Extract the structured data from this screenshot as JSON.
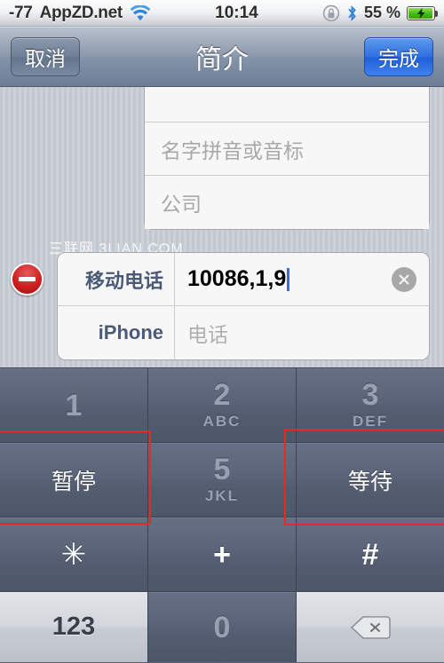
{
  "status_bar": {
    "signal_text": "-77",
    "carrier": "AppZD.net",
    "wifi_icon": "wifi-icon",
    "time": "10:14",
    "rotation_lock_icon": "rotation-lock-icon",
    "bluetooth_icon": "bluetooth-icon",
    "battery_percent": "55 %",
    "battery_icon": "battery-charging-icon"
  },
  "nav_bar": {
    "cancel_label": "取消",
    "title": "简介",
    "done_label": "完成"
  },
  "watermark": "三联网 3LIAN.COM",
  "form": {
    "name_group": {
      "rows": [
        {
          "placeholder": "名字拼音或音标"
        },
        {
          "placeholder": "公司"
        }
      ]
    },
    "phone_group": {
      "delete_icon": "delete-minus-icon",
      "rows": [
        {
          "label": "移动电话",
          "value": "10086,1,9",
          "has_caret": true,
          "clear_icon": "clear-x-icon"
        },
        {
          "label": "iPhone",
          "placeholder": "电话",
          "has_caret": false
        }
      ]
    }
  },
  "keyboard": {
    "rows": [
      [
        {
          "digit": "1",
          "sub": ""
        },
        {
          "digit": "2",
          "sub": "ABC"
        },
        {
          "digit": "3",
          "sub": "DEF"
        }
      ],
      [
        {
          "digit": "",
          "sub": "",
          "cn": "暂停"
        },
        {
          "digit": "5",
          "sub": "JKL"
        },
        {
          "digit": "",
          "sub": "",
          "cn": "等待"
        }
      ],
      [
        {
          "sym": "✳"
        },
        {
          "sym": "+"
        },
        {
          "sym": "#"
        }
      ],
      [
        {
          "num123": "123"
        },
        {
          "digit": "0",
          "sub": ""
        },
        {
          "icon": "backspace-icon"
        }
      ]
    ]
  },
  "annotations": [
    {
      "name": "pause-key-highlight",
      "color": "#e8262b"
    },
    {
      "name": "wait-key-highlight",
      "color": "#e8262b"
    }
  ]
}
